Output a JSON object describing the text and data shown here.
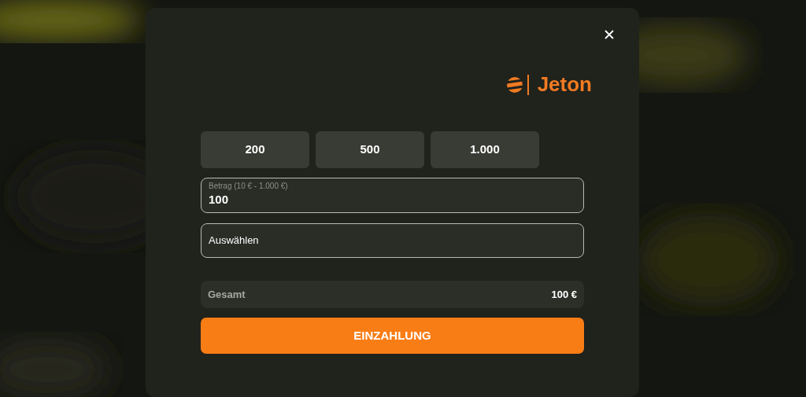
{
  "modal": {
    "logo": {
      "text": "Jeton"
    },
    "quick_amounts": [
      "200",
      "500",
      "1.000"
    ],
    "amount_field": {
      "label": "Betrag (10 € - 1.000 €)",
      "value": "100"
    },
    "method_select": {
      "placeholder": "Auswählen"
    },
    "total": {
      "label": "Gesamt",
      "value": "100 €"
    },
    "submit_button": "EINZAHLUNG"
  }
}
